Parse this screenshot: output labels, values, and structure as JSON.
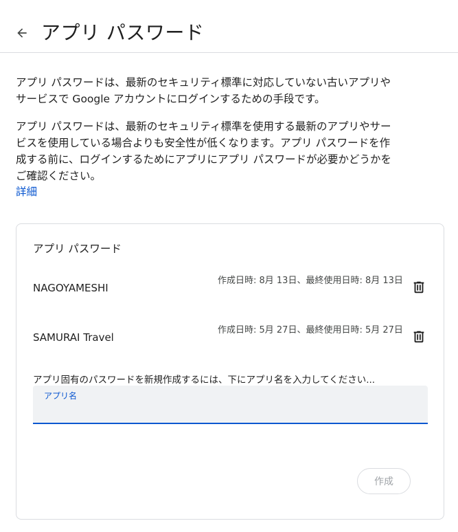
{
  "header": {
    "title": "アプリ パスワード",
    "back_icon": "arrow-back-icon"
  },
  "description": {
    "paragraph1": "アプリ パスワードは、最新のセキュリティ標準に対応していない古いアプリやサービスで Google アカウントにログインするための手段です。",
    "paragraph2": "アプリ パスワードは、最新のセキュリティ標準を使用する最新のアプリやサービスを使用している場合よりも安全性が低くなります。アプリ パスワードを作成する前に、ログインするためにアプリにアプリ パスワードが必要かどうかをご確認ください。",
    "learn_more": "詳細"
  },
  "app_passwords": {
    "title": "アプリ パスワード",
    "items": [
      {
        "name": "NAGOYAMESHI",
        "meta": "作成日時: 8月 13日、最終使用日時: 8月 13日",
        "delete_icon": "trash-icon"
      },
      {
        "name": "SAMURAI Travel",
        "meta": "作成日時: 5月 27日、最終使用日時: 5月 27日",
        "delete_icon": "trash-icon"
      }
    ],
    "create_hint": "アプリ固有のパスワードを新規作成するには、下にアプリ名を入力してください...",
    "input_label": "アプリ名",
    "input_value": "",
    "create_button": "作成"
  },
  "colors": {
    "accent": "#0b57d0",
    "text": "#1f1f1f",
    "muted": "#444746",
    "border": "#dadce0",
    "field_bg": "#f0f2f4",
    "disabled": "#a0a4a8"
  }
}
